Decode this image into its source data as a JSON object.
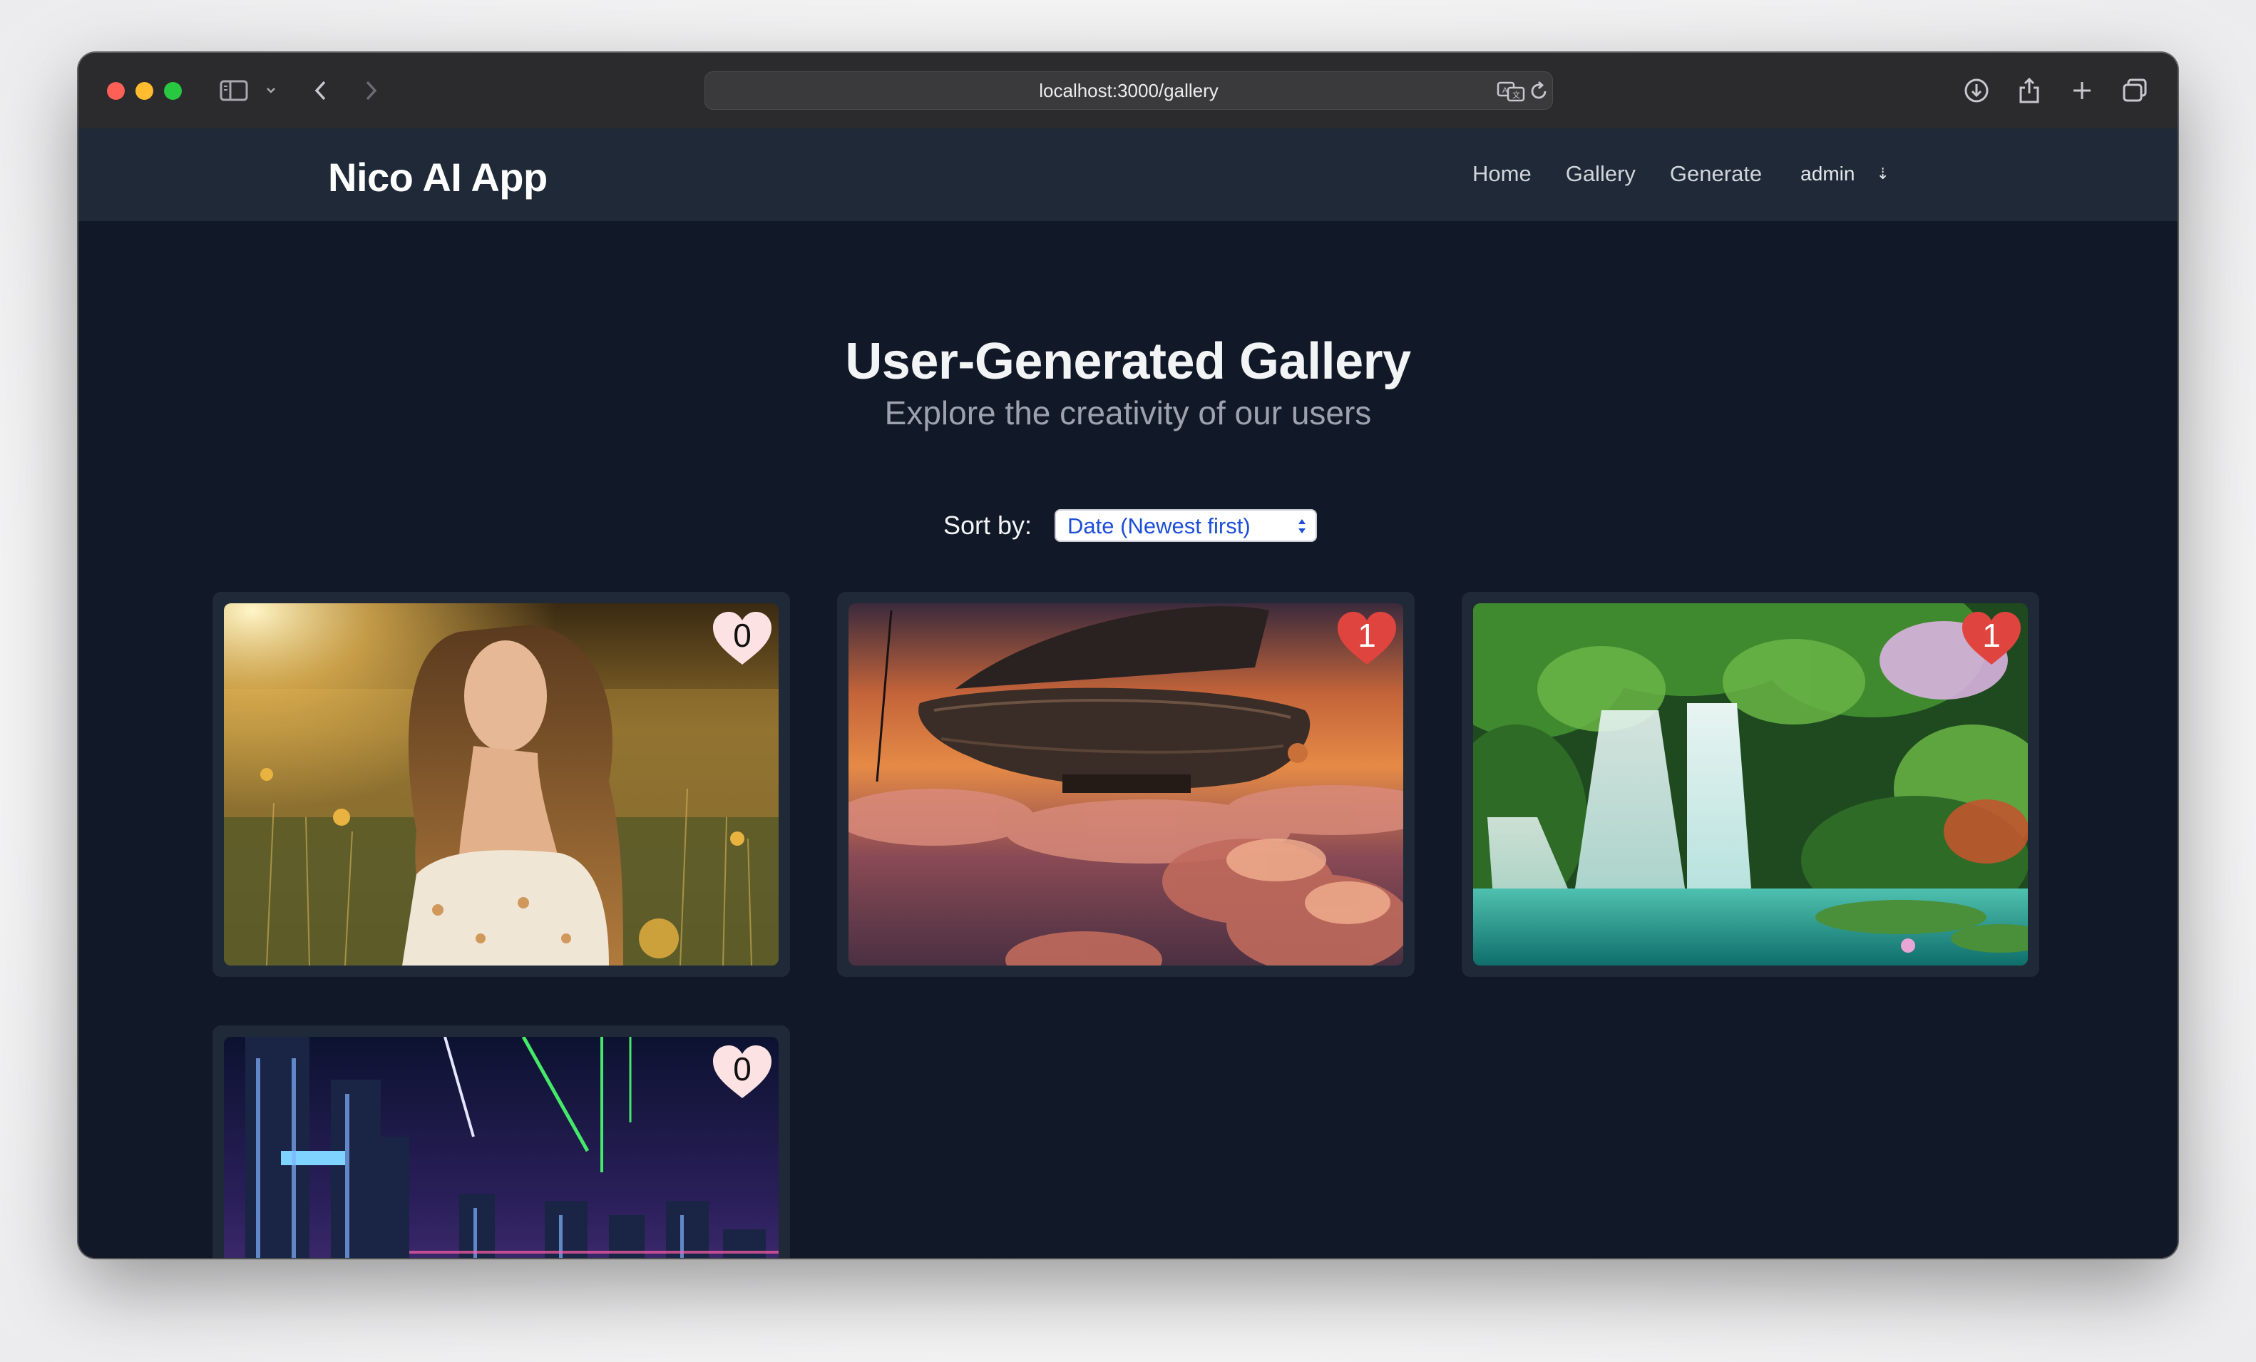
{
  "browser": {
    "url": "localhost:3000/gallery"
  },
  "app": {
    "brand": "Nico AI App",
    "nav": {
      "links": [
        "Home",
        "Gallery",
        "Generate"
      ],
      "user": "admin",
      "user_caret": "⇣"
    }
  },
  "page": {
    "title": "User-Generated Gallery",
    "subtitle": "Explore the creativity of our users",
    "sort": {
      "label": "Sort by:",
      "selected": "Date (Newest first)"
    }
  },
  "gallery": {
    "items": [
      {
        "subject": "woman in flower field at sunset",
        "likes": "0",
        "liked": false
      },
      {
        "subject": "steampunk airship above clouds",
        "likes": "1",
        "liked": true
      },
      {
        "subject": "jungle waterfall into turquoise lake",
        "likes": "1",
        "liked": true
      },
      {
        "subject": "neon cyberpunk city skyline",
        "likes": "0",
        "liked": false
      }
    ]
  },
  "colors": {
    "page_bg": "#111827",
    "nav_bg": "#1f2937",
    "card_bg": "#1f2937",
    "heart_liked": "#ef4444",
    "heart_empty": "#fde2e4",
    "select_text": "#1d4ed8"
  }
}
